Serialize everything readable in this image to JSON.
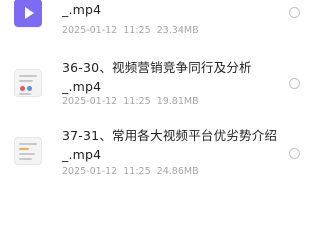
{
  "files": [
    {
      "name_line1": "",
      "name_line2": "_.mp4",
      "date": "2025-01-12",
      "time": "11:25",
      "size": "23.34MB",
      "thumb": "video-play-icon"
    },
    {
      "name_line1": "36-30、视频营销竞争同行及分析",
      "name_line2": "_.mp4",
      "date": "2025-01-12",
      "time": "11:25",
      "size": "19.81MB",
      "thumb": "document-thumbnail"
    },
    {
      "name_line1": "37-31、常用各大视频平台优劣势介绍",
      "name_line2": "_.mp4",
      "date": "2025-01-12",
      "time": "11:25",
      "size": "24.86MB",
      "thumb": "document-thumbnail"
    }
  ]
}
